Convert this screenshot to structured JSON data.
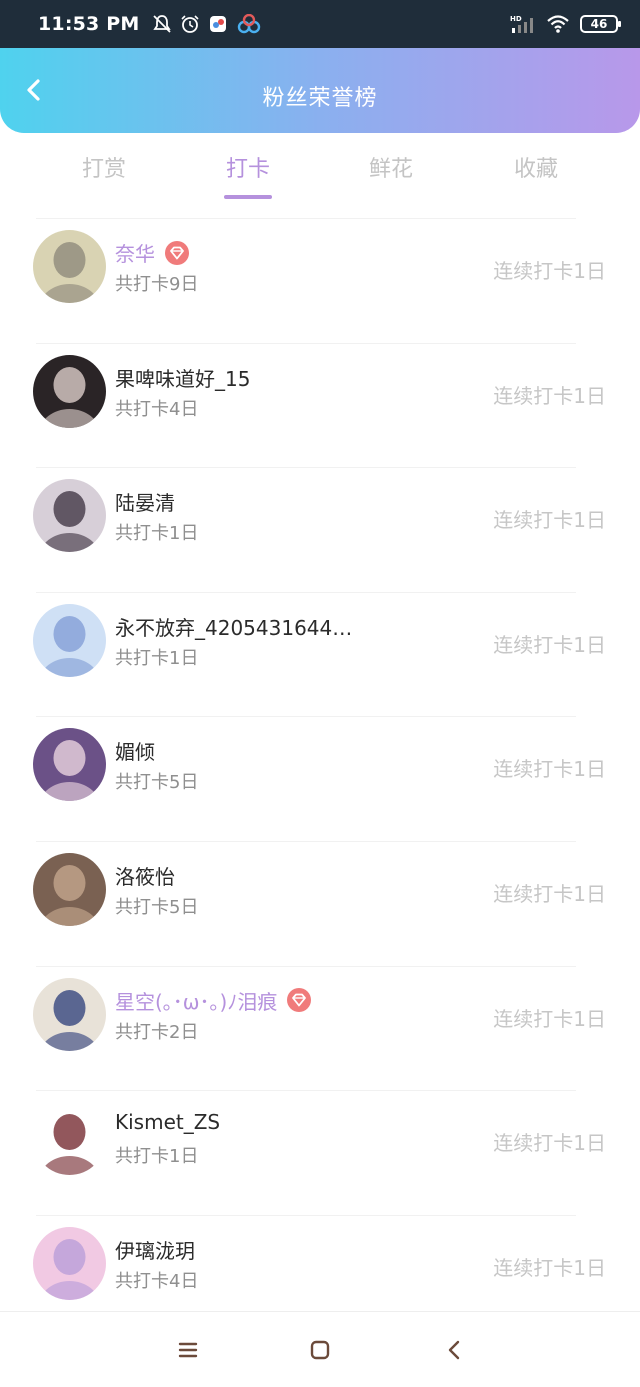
{
  "status_bar": {
    "time": "11:53 PM",
    "battery": "46",
    "network": "HD"
  },
  "header": {
    "title": "粉丝荣誉榜",
    "back_icon": "back-chevron-icon"
  },
  "tabs": [
    {
      "label": "打赏",
      "active": false
    },
    {
      "label": "打卡",
      "active": true
    },
    {
      "label": "鲜花",
      "active": false
    },
    {
      "label": "收藏",
      "active": false
    }
  ],
  "fans": [
    {
      "name": "奈华",
      "vip": true,
      "total": "共打卡9日",
      "streak": "连续打卡1日",
      "avatar_colors": [
        "#d9d3b3",
        "#8a8678"
      ]
    },
    {
      "name": "果啤味道好_15",
      "vip": false,
      "total": "共打卡4日",
      "streak": "连续打卡1日",
      "avatar_colors": [
        "#2a2426",
        "#e8d8d4"
      ]
    },
    {
      "name": "陆晏清",
      "vip": false,
      "total": "共打卡1日",
      "streak": "连续打卡1日",
      "avatar_colors": [
        "#d7cfd8",
        "#3a2f3d"
      ]
    },
    {
      "name": "永不放弃_42054316449...",
      "vip": false,
      "total": "共打卡1日",
      "streak": "连续打卡1日",
      "avatar_colors": [
        "#cfe0f5",
        "#7f9bd4"
      ]
    },
    {
      "name": "媚倾",
      "vip": false,
      "total": "共打卡5日",
      "streak": "连续打卡1日",
      "avatar_colors": [
        "#6b5187",
        "#f1dce4"
      ]
    },
    {
      "name": "洛筱怡",
      "vip": false,
      "total": "共打卡5日",
      "streak": "连续打卡1日",
      "avatar_colors": [
        "#7a6152",
        "#c9ab92"
      ]
    },
    {
      "name": "星空(｡･ω･｡)ﾉ泪痕",
      "vip": true,
      "total": "共打卡2日",
      "streak": "连续打卡1日",
      "avatar_colors": [
        "#e8e2d8",
        "#2b3c7a"
      ]
    },
    {
      "name": "Kismet_ZS",
      "vip": false,
      "total": "共打卡1日",
      "streak": "连续打卡1日",
      "avatar_colors": [
        "#ffffff",
        "#6e1f26"
      ]
    },
    {
      "name": "伊璃泷玥",
      "vip": false,
      "total": "共打卡4日",
      "streak": "连续打卡1日",
      "avatar_colors": [
        "#f1c9e3",
        "#b59bd8"
      ]
    }
  ],
  "colors": {
    "accent": "#b591dd",
    "header_start": "#4fd2ee",
    "header_end": "#b898ea",
    "gem": "#f07b7b"
  }
}
